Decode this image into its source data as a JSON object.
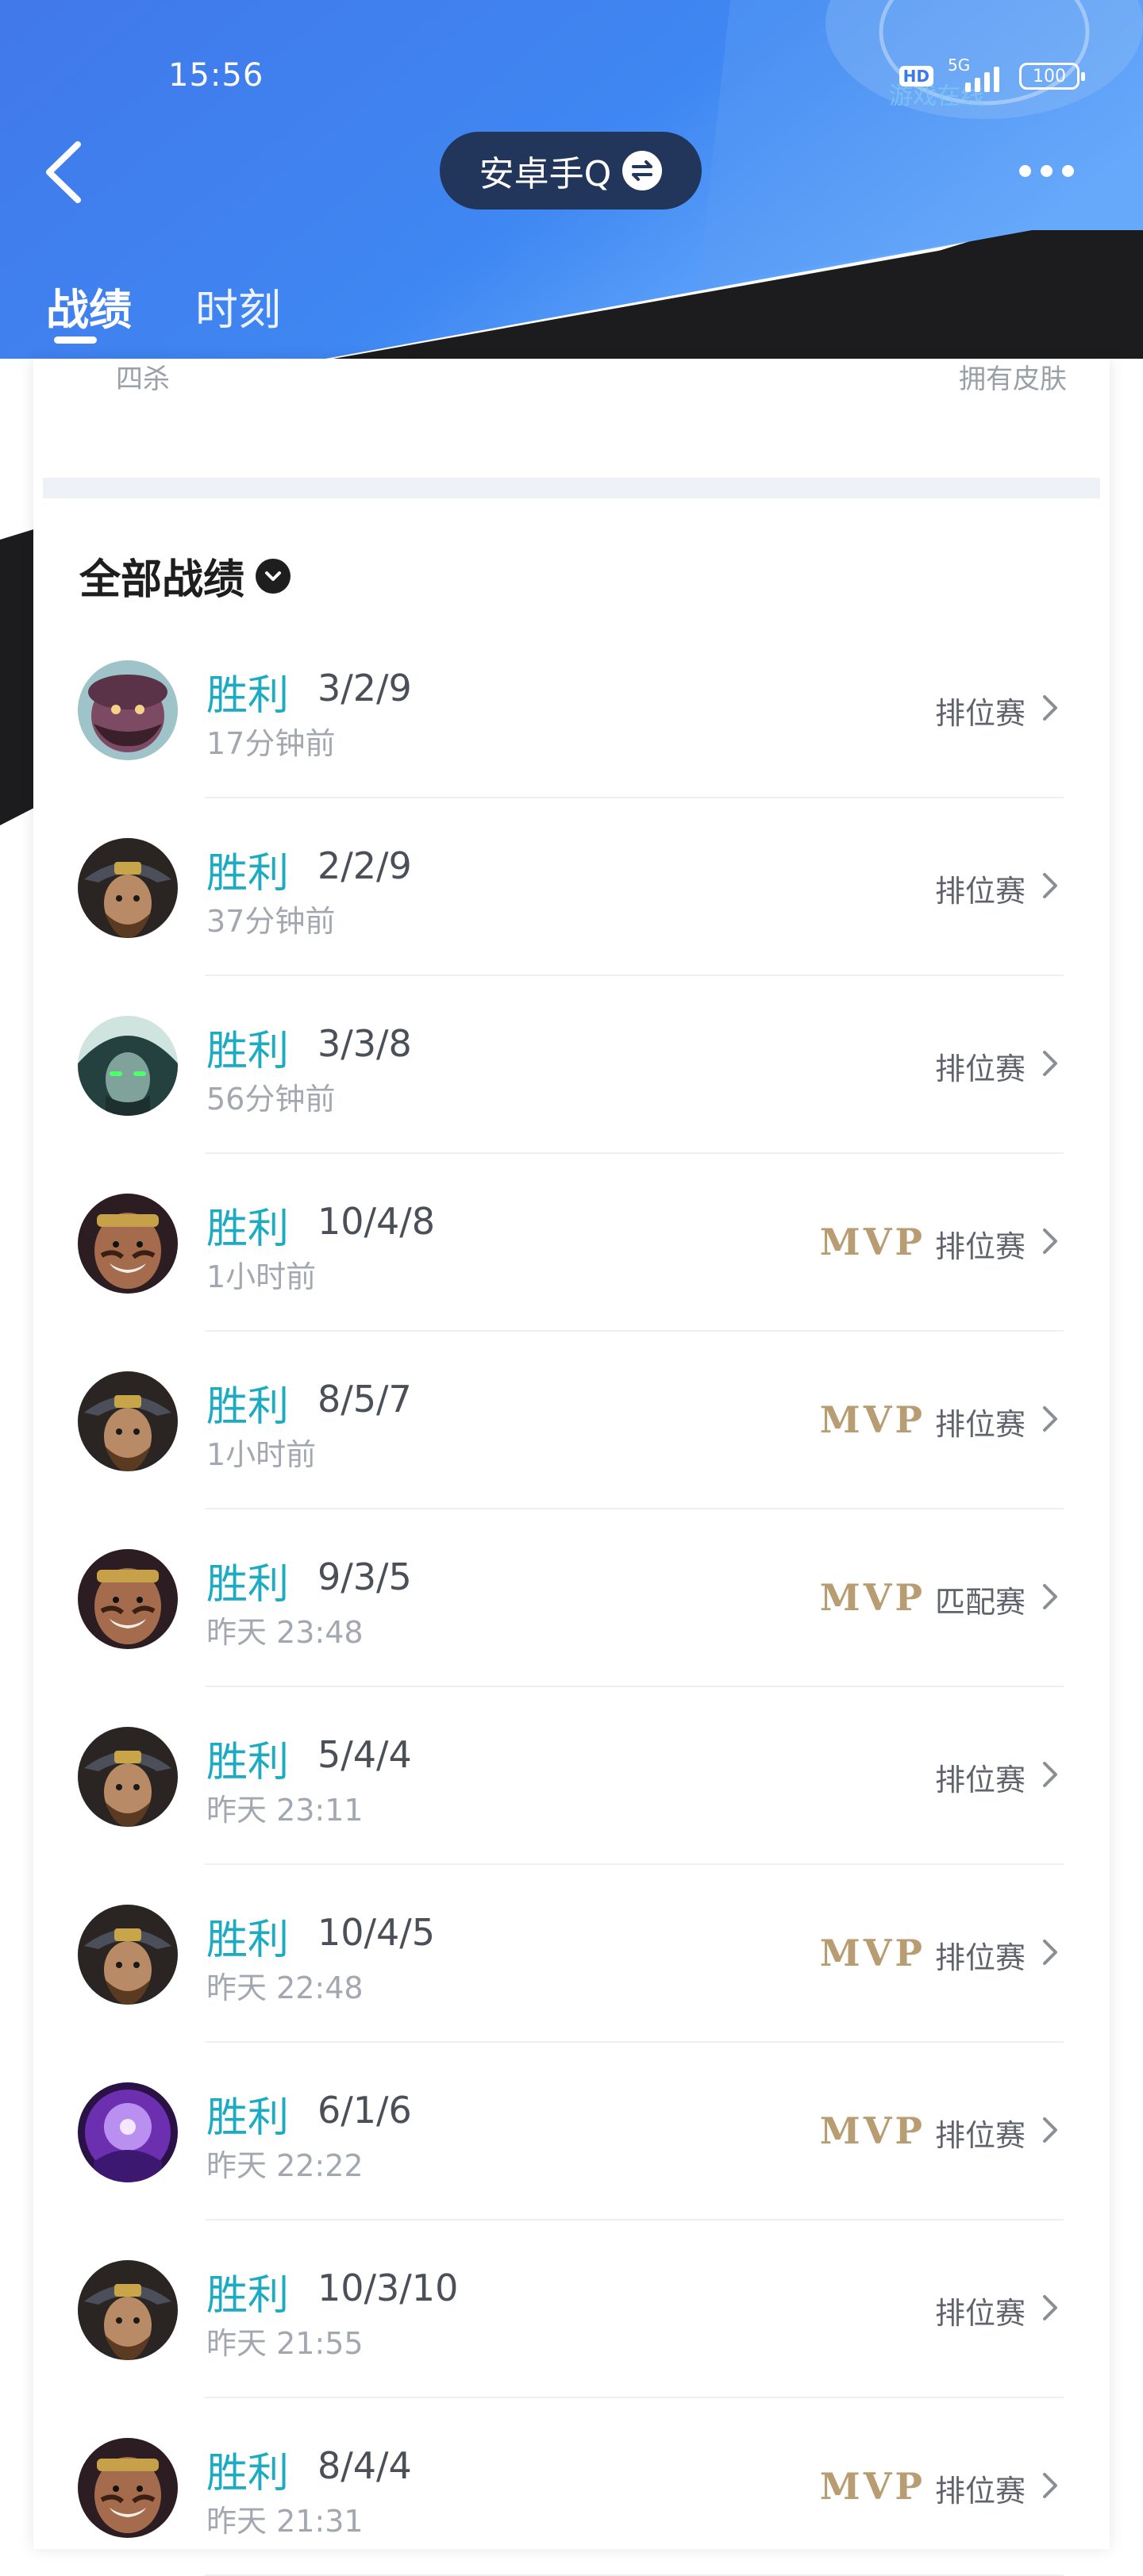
{
  "status_bar": {
    "time": "15:56",
    "hd": "HD",
    "network": "5G",
    "battery": "100",
    "overlay_text": "游戏在线"
  },
  "nav": {
    "account_name": "安卓手Q",
    "icons": {
      "back": "back-arrow-icon",
      "switch": "switch-account-icon",
      "more": "more-dots-icon"
    }
  },
  "tabs": [
    {
      "label": "战绩",
      "active": true
    },
    {
      "label": "时刻",
      "active": false
    }
  ],
  "stats_partial": {
    "left_label": "四杀",
    "right_label": "拥有皮肤"
  },
  "section": {
    "title": "全部战绩"
  },
  "colors": {
    "header_blue": "#3d7ff0",
    "win_teal": "#1cabc0",
    "mvp_gold": "#b89c72",
    "pill_dark": "#22355a"
  },
  "matches": [
    {
      "hero_icon": "hero-avatar-mustache",
      "result": "胜利",
      "kda": "3/2/9",
      "time": "17分钟前",
      "mvp": false,
      "mode": "排位赛"
    },
    {
      "hero_icon": "hero-avatar-gunslinger",
      "result": "胜利",
      "kda": "2/2/9",
      "time": "37分钟前",
      "mvp": false,
      "mode": "排位赛"
    },
    {
      "hero_icon": "hero-avatar-assassin",
      "result": "胜利",
      "kda": "3/3/8",
      "time": "56分钟前",
      "mvp": false,
      "mode": "排位赛"
    },
    {
      "hero_icon": "hero-avatar-grin",
      "result": "胜利",
      "kda": "10/4/8",
      "time": "1小时前",
      "mvp": true,
      "mode": "排位赛"
    },
    {
      "hero_icon": "hero-avatar-gunslinger",
      "result": "胜利",
      "kda": "8/5/7",
      "time": "1小时前",
      "mvp": true,
      "mode": "排位赛"
    },
    {
      "hero_icon": "hero-avatar-grin",
      "result": "胜利",
      "kda": "9/3/5",
      "time": "昨天 23:48",
      "mvp": true,
      "mode": "匹配赛"
    },
    {
      "hero_icon": "hero-avatar-gunslinger",
      "result": "胜利",
      "kda": "5/4/4",
      "time": "昨天 23:11",
      "mvp": false,
      "mode": "排位赛"
    },
    {
      "hero_icon": "hero-avatar-gunslinger",
      "result": "胜利",
      "kda": "10/4/5",
      "time": "昨天 22:48",
      "mvp": true,
      "mode": "排位赛"
    },
    {
      "hero_icon": "hero-avatar-purple",
      "result": "胜利",
      "kda": "6/1/6",
      "time": "昨天 22:22",
      "mvp": true,
      "mode": "排位赛"
    },
    {
      "hero_icon": "hero-avatar-gunslinger",
      "result": "胜利",
      "kda": "10/3/10",
      "time": "昨天 21:55",
      "mvp": false,
      "mode": "排位赛"
    },
    {
      "hero_icon": "hero-avatar-grin",
      "result": "胜利",
      "kda": "8/4/4",
      "time": "昨天 21:31",
      "mvp": true,
      "mode": "排位赛"
    }
  ],
  "mvp_label": "MVP"
}
